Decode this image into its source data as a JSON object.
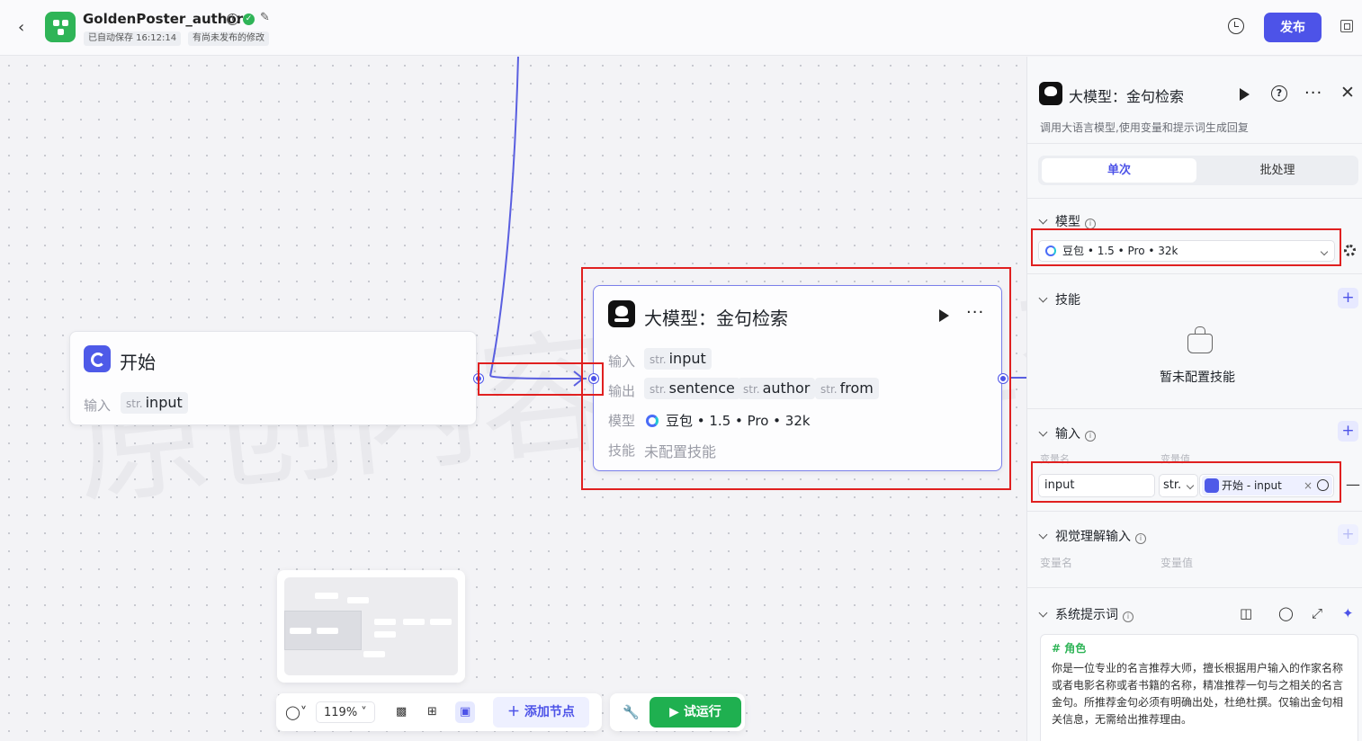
{
  "header": {
    "back_icon": "chevron-left-icon",
    "app_title": "GoldenPoster_author",
    "autosave_status": "已自动保存 16:12:14",
    "unpublished_status": "有尚未发布的修改",
    "publish_label": "发布"
  },
  "canvas": {
    "watermark": "原创内容宇宙仨杰",
    "start_node": {
      "title": "开始",
      "input_label": "输入",
      "input_type": "str.",
      "input_name": "input"
    },
    "llm_node": {
      "title": "大模型：金句检索",
      "input_label": "输入",
      "output_label": "输出",
      "model_label": "模型",
      "skill_label": "技能",
      "input": {
        "type": "str.",
        "name": "input"
      },
      "outputs": [
        {
          "type": "str.",
          "name": "sentence"
        },
        {
          "type": "str.",
          "name": "author"
        },
        {
          "type": "str.",
          "name": "from"
        }
      ],
      "model_value": "豆包 • 1.5 • Pro • 32k",
      "skill_value": "未配置技能"
    },
    "toolbar": {
      "zoom": "119%",
      "add_node_label": "添加节点",
      "trial_run_label": "试运行"
    }
  },
  "panel": {
    "title": "大模型：金句检索",
    "description": "调用大语言模型,使用变量和提示词生成回复",
    "tabs": [
      "单次",
      "批处理"
    ],
    "model_section": {
      "title": "模型",
      "value": "豆包 • 1.5 • Pro • 32k"
    },
    "skill_section": {
      "title": "技能",
      "empty_text": "暂未配置技能"
    },
    "input_section": {
      "title": "输入",
      "col_name": "变量名",
      "col_value": "变量值",
      "var_name": "input",
      "var_type": "str.",
      "ref_value": "开始 - input"
    },
    "vision_section": {
      "title": "视觉理解输入",
      "col_name": "变量名",
      "col_value": "变量值"
    },
    "prompt_section": {
      "title": "系统提示词",
      "heading": "# 角色",
      "body": "你是一位专业的名言推荐大师，擅长根据用户输入的作家名称或者电影名称或者书籍的名称，精准推荐一句与之相关的名言金句。所推荐金句必须有明确出处，杜绝杜撰。仅输出金句相关信息，无需给出推荐理由。"
    }
  }
}
